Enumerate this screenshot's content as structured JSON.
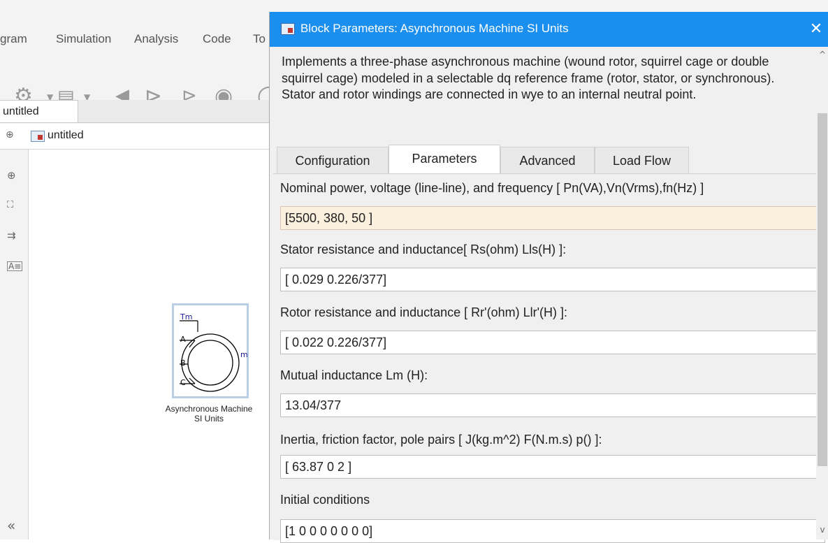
{
  "simulink": {
    "menu": [
      "gram",
      "Simulation",
      "Analysis",
      "Code",
      "To"
    ],
    "model_tab": "untitled",
    "address": "untitled",
    "block": {
      "ports_in": [
        "Tm",
        "A",
        "B",
        "C"
      ],
      "port_out": "m",
      "name_line1": "Asynchronous Machine",
      "name_line2": "SI Units"
    },
    "collapse_glyph": "«"
  },
  "dialog": {
    "title": "Block Parameters: Asynchronous Machine SI Units",
    "close_glyph": "✕",
    "description": "Implements a three-phase asynchronous machine (wound rotor, squirrel cage or double squirrel cage) modeled in a selectable dq reference frame (rotor, stator, or synchronous). Stator and rotor windings are connected in wye to an internal neutral point.",
    "tabs": [
      "Configuration",
      "Parameters",
      "Advanced",
      "Load Flow"
    ],
    "active_tab": "Parameters",
    "params": [
      {
        "label": "Nominal power, voltage (line-line), and frequency [ Pn(VA),Vn(Vrms),fn(Hz) ]",
        "value": "[5500, 380, 50 ]"
      },
      {
        "label": "Stator resistance and inductance[ Rs(ohm)  Lls(H) ]:",
        "value": "[ 0.029 0.226/377]"
      },
      {
        "label": "Rotor resistance and inductance [ Rr'(ohm)  Llr'(H) ]:",
        "value": "[ 0.022 0.226/377]"
      },
      {
        "label": "Mutual inductance Lm (H):",
        "value": "13.04/377"
      },
      {
        "label": "Inertia, friction factor, pole pairs [ J(kg.m^2)  F(N.m.s)   p() ]:",
        "value": "[ 63.87 0  2 ]"
      },
      {
        "label": "Initial conditions",
        "value": "[1 0 0 0 0 0 0 0]"
      }
    ]
  }
}
